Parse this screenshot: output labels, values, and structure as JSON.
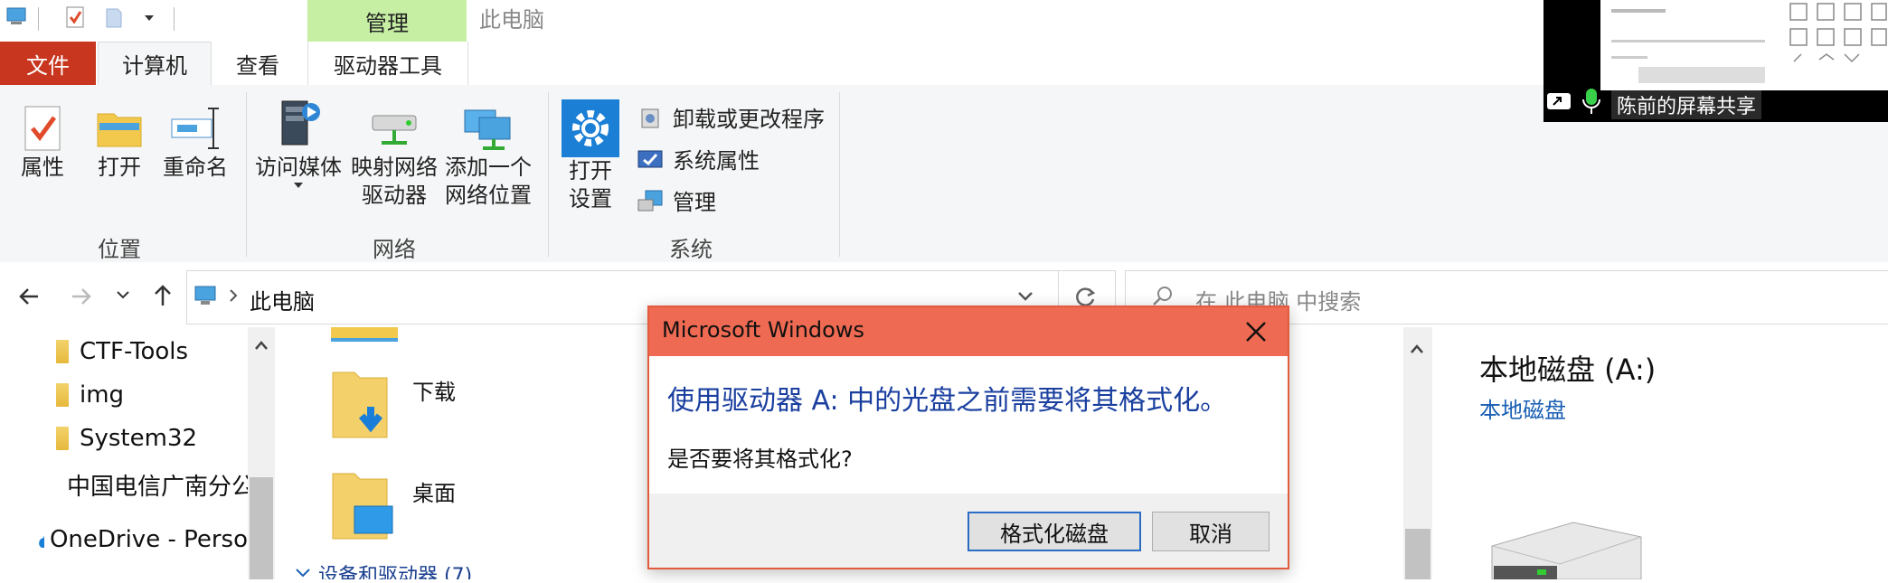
{
  "window": {
    "title": "此电脑",
    "context_tab": "管理"
  },
  "ribbon": {
    "tabs": {
      "file": "文件",
      "computer": "计算机",
      "view": "查看",
      "drive_tools": "驱动器工具"
    },
    "location_group": {
      "label": "位置",
      "properties": "属性",
      "open": "打开",
      "rename": "重命名"
    },
    "network_group": {
      "label": "网络",
      "access_media": "访问媒体",
      "map_drive_1": "映射网络",
      "map_drive_2": "驱动器",
      "add_location_1": "添加一个",
      "add_location_2": "网络位置"
    },
    "system_group": {
      "label": "系统",
      "open_settings_1": "打开",
      "open_settings_2": "设置",
      "uninstall": "卸载或更改程序",
      "system_properties": "系统属性",
      "manage": "管理"
    }
  },
  "address": {
    "path": "此电脑",
    "search_placeholder": "在 此电脑 中搜索"
  },
  "sidebar": {
    "items": [
      "CTF-Tools",
      "img",
      "System32",
      "中国电信广南分公",
      "OneDrive - Perso"
    ]
  },
  "content": {
    "folders": [
      "下载",
      "桌面"
    ],
    "section": "设备和驱动器 (7)"
  },
  "details": {
    "title": "本地磁盘 (A:)",
    "subtitle": "本地磁盘"
  },
  "dialog": {
    "title": "Microsoft Windows",
    "headline": "使用驱动器 A: 中的光盘之前需要将其格式化。",
    "question": "是否要将其格式化?",
    "format_button": "格式化磁盘",
    "cancel_button": "取消"
  },
  "screen_share": {
    "label": "陈前的屏幕共享"
  }
}
